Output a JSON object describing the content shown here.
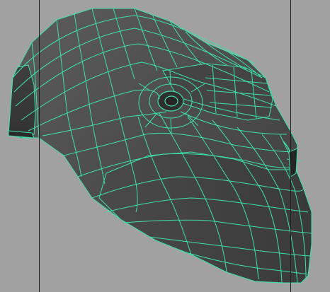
{
  "viewport": {
    "background_color": "#a1a1a1",
    "guide_line_color": "#1e1e1e"
  },
  "mesh": {
    "object": "head-polygon-mesh",
    "display_mode": "shaded-with-wireframe-on-shaded",
    "selected": true,
    "wire_color": "#3fe0a8",
    "shade_dark": "#3a3a3a",
    "shade_mid": "#4e4e4e",
    "shade_light": "#666666"
  }
}
